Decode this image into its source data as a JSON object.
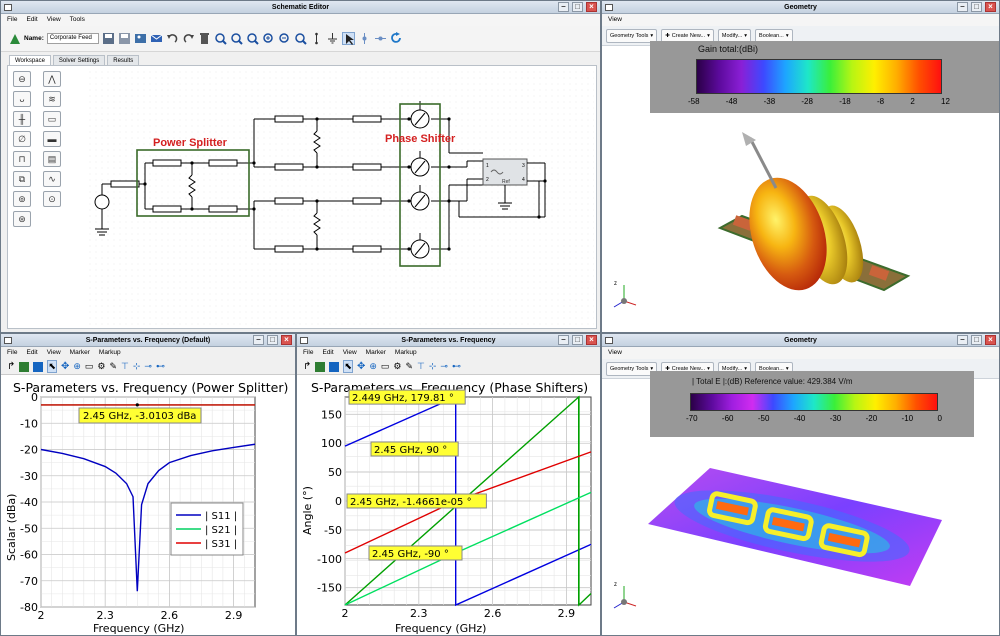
{
  "schematic": {
    "title": "Schematic Editor",
    "menu": [
      "File",
      "Edit",
      "View",
      "Tools"
    ],
    "name_label": "Name:",
    "name_value": "Corporate Feed",
    "tabs": [
      "Workspace",
      "Solver Settings",
      "Results"
    ],
    "power_splitter": "Power Splitter",
    "phase_shifter": "Phase Shifter",
    "ref_label": "Ref",
    "ports": [
      "1",
      "2",
      "3",
      "4"
    ]
  },
  "geometry_top": {
    "title": "Geometry",
    "menu": [
      "View"
    ],
    "toolbar": [
      "Geometry Tools",
      "Create New...",
      "Modify...",
      "Boolean..."
    ],
    "scale_title": "Gain total:(dBi)",
    "ticks": [
      "-58",
      "-48",
      "-38",
      "-28",
      "-18",
      "-8",
      "2",
      "12"
    ]
  },
  "geometry_bottom": {
    "title": "Geometry",
    "menu": [
      "View"
    ],
    "toolbar": [
      "Geometry Tools",
      "Create New...",
      "Modify...",
      "Boolean..."
    ],
    "scale_title": "| Total E |:(dB) Reference value: 429.384 V/m",
    "ticks": [
      "-70",
      "-60",
      "-50",
      "-40",
      "-30",
      "-20",
      "-10",
      "0"
    ]
  },
  "axis_letters": {
    "x": "x",
    "y": "y",
    "z": "z"
  },
  "plot1": {
    "window_title": "S-Parameters vs. Frequency (Default)",
    "menu": [
      "File",
      "Edit",
      "View",
      "Marker",
      "Markup"
    ],
    "chart_data": {
      "type": "line",
      "title": "S-Parameters vs. Frequency (Power Splitter)",
      "xlabel": "Frequency (GHz)",
      "ylabel": "Scalar (dBa)",
      "xlim": [
        2,
        3
      ],
      "ylim": [
        -80,
        0
      ],
      "xticks": [
        "2",
        "2.3",
        "2.6",
        "2.9"
      ],
      "yticks": [
        "0",
        "-10",
        "-20",
        "-30",
        "-40",
        "-50",
        "-60",
        "-70",
        "-80"
      ],
      "legend": [
        "| S11 |",
        "| S21 |",
        "| S31 |"
      ],
      "legend_position": "lower-right",
      "series_colors": [
        "#0000c0",
        "#00d060",
        "#e00000"
      ],
      "marker_label": "2.45 GHz, -3.0103 dBa",
      "series": [
        {
          "name": "| S11 |",
          "x": [
            2,
            2.1,
            2.2,
            2.3,
            2.35,
            2.4,
            2.43,
            2.45,
            2.47,
            2.5,
            2.55,
            2.6,
            2.7,
            2.8,
            2.9,
            3
          ],
          "y": [
            -20,
            -21.5,
            -23.5,
            -26.5,
            -29,
            -33,
            -38,
            -74,
            -41,
            -33,
            -28,
            -25,
            -22.3,
            -20.5,
            -19.2,
            -18
          ]
        },
        {
          "name": "| S21 |",
          "x": [
            2,
            3
          ],
          "y": [
            -3.0103,
            -3.0103
          ]
        },
        {
          "name": "| S31 |",
          "x": [
            2,
            3
          ],
          "y": [
            -3.0103,
            -3.0103
          ]
        }
      ]
    }
  },
  "plot2": {
    "window_title": "S-Parameters vs. Frequency",
    "menu": [
      "File",
      "Edit",
      "View",
      "Marker",
      "Markup"
    ],
    "chart_data": {
      "type": "line",
      "title": "S-Parameters vs. Frequency (Phase Shifters)",
      "xlabel": "Frequency (GHz)",
      "ylabel": "Angle (°)",
      "xlim": [
        2,
        3
      ],
      "ylim": [
        -180,
        180
      ],
      "xticks": [
        "2",
        "2.3",
        "2.6",
        "2.9"
      ],
      "yticks": [
        "150",
        "100",
        "50",
        "0",
        "-50",
        "-100",
        "-150"
      ],
      "series_colors": [
        "#0000e0",
        "#00a000",
        "#e00000",
        "#00e060"
      ],
      "markers": [
        "2.449 GHz, 179.81 °",
        "2.45 GHz, 90 °",
        "2.45 GHz, -1.4661e-05 °",
        "2.45 GHz, -90 °"
      ],
      "series": [
        {
          "x": [
            2,
            2.449,
            2.45,
            3
          ],
          "y": [
            95,
            179.81,
            -180,
            -75
          ]
        },
        {
          "x": [
            2,
            2.95,
            2.951,
            3
          ],
          "y": [
            -180,
            180,
            -180,
            -160
          ]
        },
        {
          "x": [
            2,
            2.45,
            3
          ],
          "y": [
            -90,
            0,
            85
          ]
        },
        {
          "x": [
            2,
            2.45,
            3
          ],
          "y": [
            -180,
            -90,
            15
          ]
        }
      ]
    }
  }
}
